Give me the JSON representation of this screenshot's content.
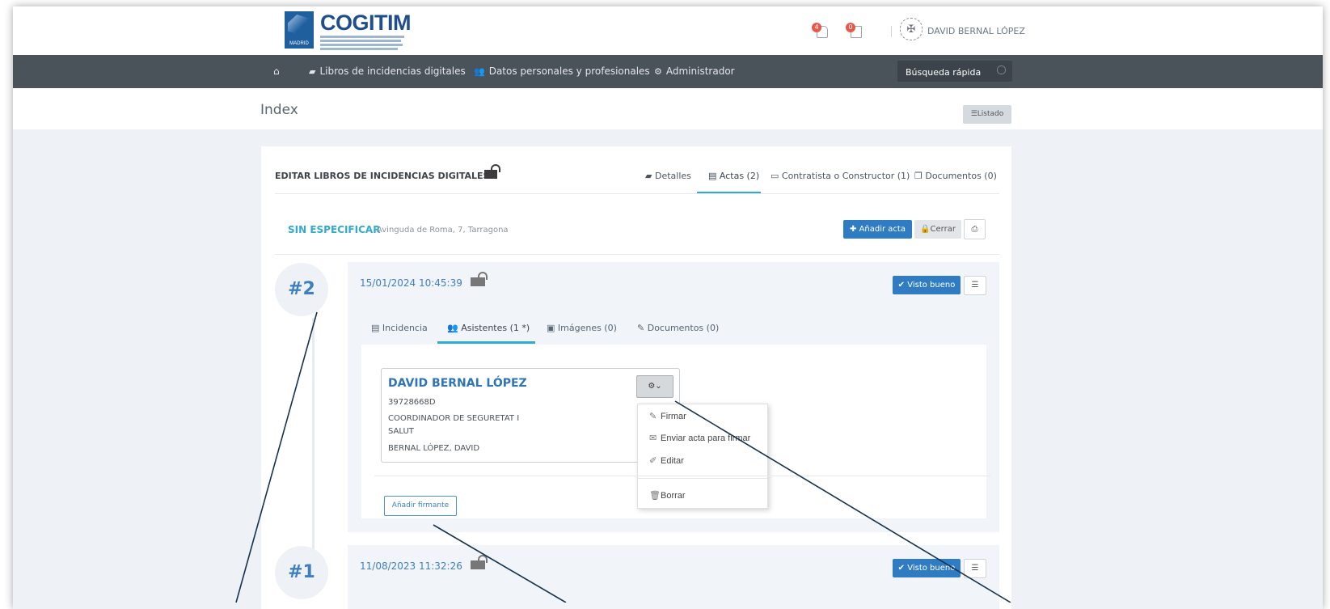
{
  "header": {
    "logo": {
      "name": "COGITIM",
      "city": "MADRID"
    },
    "notifications": [
      {
        "name": "bell-icon",
        "count": "4"
      },
      {
        "name": "calendar-icon",
        "count": "0"
      }
    ],
    "user": {
      "name": "DAVID BERNAL LÓPEZ"
    }
  },
  "nav": {
    "items": [
      {
        "label": "Libros de incidencias digitales",
        "icon": "book-icon"
      },
      {
        "label": "Datos personales y profesionales",
        "icon": "users-icon"
      },
      {
        "label": "Administrador",
        "icon": "gears-icon"
      }
    ],
    "search_placeholder": "Búsqueda rápida"
  },
  "page": {
    "title": "Index",
    "listado_label": "Listado"
  },
  "card": {
    "title": "EDITAR LIBROS DE INCIDENCIAS DIGITALES",
    "tabs": [
      {
        "label": "Detalles"
      },
      {
        "label": "Actas (2)",
        "active": true
      },
      {
        "label": "Contratista o Constructor (1)"
      },
      {
        "label": "Documentos (0)"
      }
    ],
    "status": "SIN ESPECIFICAR",
    "address": "Avinguda de Roma, 7, Tarragona",
    "add_acta": "Añadir acta",
    "cerrar": "Cerrar"
  },
  "actas": [
    {
      "number": "#2",
      "date": "15/01/2024 10:45:39",
      "visto_bueno": "Visto bueno",
      "tabs": [
        {
          "label": "Incidencia"
        },
        {
          "label": "Asistentes (1 *)",
          "active": true
        },
        {
          "label": "Imágenes (0)"
        },
        {
          "label": "Documentos (0)"
        }
      ],
      "asistente": {
        "name": "DAVID BERNAL LÓPEZ",
        "dni": "39728668D",
        "role_line1": "COORDINADOR DE SEGURETAT I",
        "role_line2": "SALUT",
        "full_name": "BERNAL LÓPEZ, DAVID"
      },
      "actions_menu": [
        "Firmar",
        "Enviar acta para firmar",
        "Editar",
        "Borrar"
      ],
      "add_firmante": "Añadir firmante"
    },
    {
      "number": "#1",
      "date": "11/08/2023 11:32:26",
      "visto_bueno": "Visto bueno"
    }
  ],
  "colors": {
    "navbar": "#4a525a",
    "accent": "#33aacc",
    "primary_button": "#2f7cc3",
    "link_blue": "#2f74b5",
    "annotation_line": "#16324f"
  }
}
